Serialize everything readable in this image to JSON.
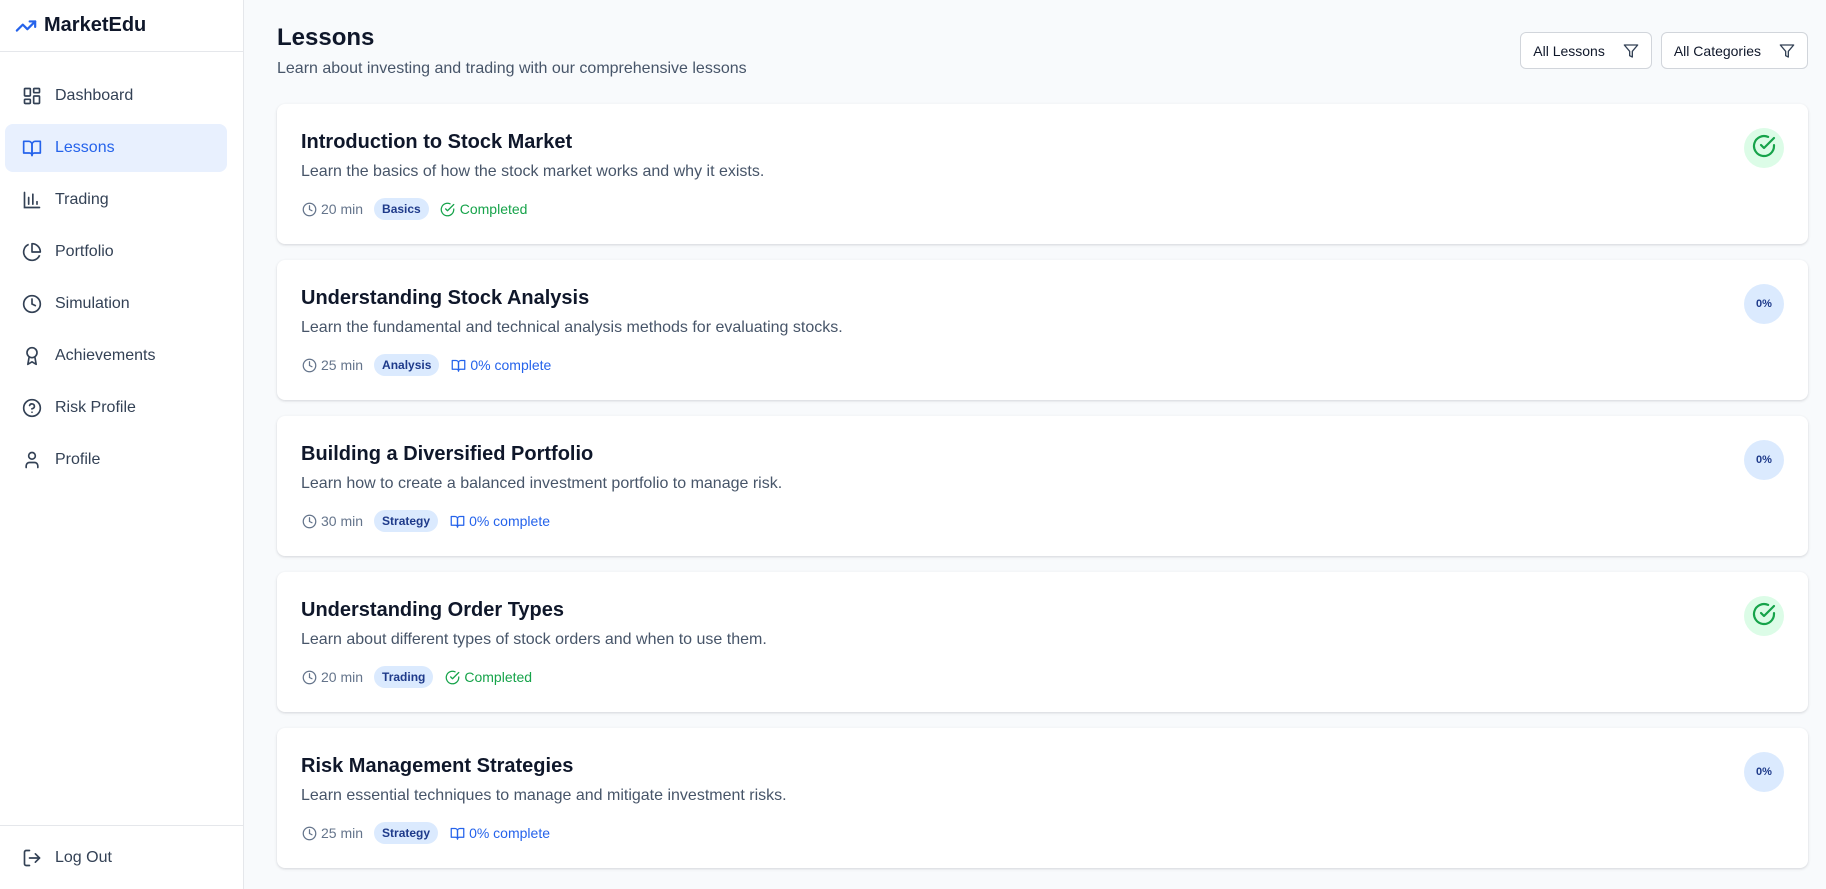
{
  "app": {
    "name": "MarketEdu",
    "logo_icon": "trending-up-icon",
    "accent": "#2563eb"
  },
  "sidebar": {
    "items": [
      {
        "label": "Dashboard",
        "icon": "dashboard-icon"
      },
      {
        "label": "Lessons",
        "icon": "book-open-icon",
        "active": true
      },
      {
        "label": "Trading",
        "icon": "bar-chart-icon"
      },
      {
        "label": "Portfolio",
        "icon": "pie-chart-icon"
      },
      {
        "label": "Simulation",
        "icon": "clock-icon"
      },
      {
        "label": "Achievements",
        "icon": "award-icon"
      },
      {
        "label": "Risk Profile",
        "icon": "help-circle-icon"
      },
      {
        "label": "Profile",
        "icon": "user-icon"
      }
    ],
    "logout": {
      "label": "Log Out",
      "icon": "log-out-icon"
    }
  },
  "page": {
    "title": "Lessons",
    "subtitle": "Learn about investing and trading with our comprehensive lessons"
  },
  "filters": {
    "lessons": {
      "value": "All Lessons",
      "icon": "filter-icon"
    },
    "categories": {
      "value": "All Categories",
      "icon": "filter-icon"
    }
  },
  "lessons": [
    {
      "title": "Introduction to Stock Market",
      "description": "Learn the basics of how the stock market works and why it exists.",
      "duration": "20 min",
      "category": "Basics",
      "status": "Completed",
      "completed": true
    },
    {
      "title": "Understanding Stock Analysis",
      "description": "Learn the fundamental and technical analysis methods for evaluating stocks.",
      "duration": "25 min",
      "category": "Analysis",
      "status": "0% complete",
      "completed": false,
      "progress_label": "0%"
    },
    {
      "title": "Building a Diversified Portfolio",
      "description": "Learn how to create a balanced investment portfolio to manage risk.",
      "duration": "30 min",
      "category": "Strategy",
      "status": "0% complete",
      "completed": false,
      "progress_label": "0%"
    },
    {
      "title": "Understanding Order Types",
      "description": "Learn about different types of stock orders and when to use them.",
      "duration": "20 min",
      "category": "Trading",
      "status": "Completed",
      "completed": true
    },
    {
      "title": "Risk Management Strategies",
      "description": "Learn essential techniques to manage and mitigate investment risks.",
      "duration": "25 min",
      "category": "Strategy",
      "status": "0% complete",
      "completed": false,
      "progress_label": "0%"
    }
  ],
  "colors": {
    "completed": "#16a34a",
    "progress": "#2563eb",
    "badge_bg": "#dbeafe"
  }
}
